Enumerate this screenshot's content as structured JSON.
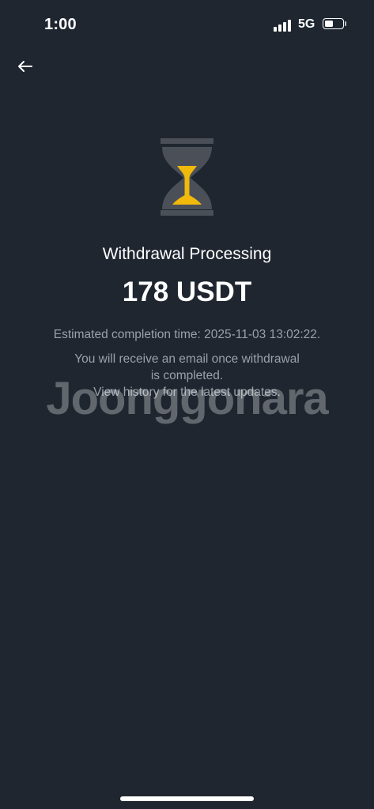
{
  "status_bar": {
    "time": "1:00",
    "network": "5G",
    "battery_level": 0.55
  },
  "header": {
    "back_icon": "arrow-left-icon"
  },
  "main": {
    "status_icon": "hourglass-icon",
    "title": "Withdrawal Processing",
    "amount": "178 USDT",
    "estimated_completion": "Estimated completion time: 2025-11-03 13:02:22.",
    "message_lines": [
      "You will receive an email once withdrawal",
      "is completed.",
      "View history for the latest updates."
    ]
  },
  "watermark": "Joonggonara",
  "colors": {
    "background": "#1f2630",
    "accent": "#f0b90b",
    "icon_gray": "#4a4f58",
    "secondary_text": "#9aa1ab"
  }
}
